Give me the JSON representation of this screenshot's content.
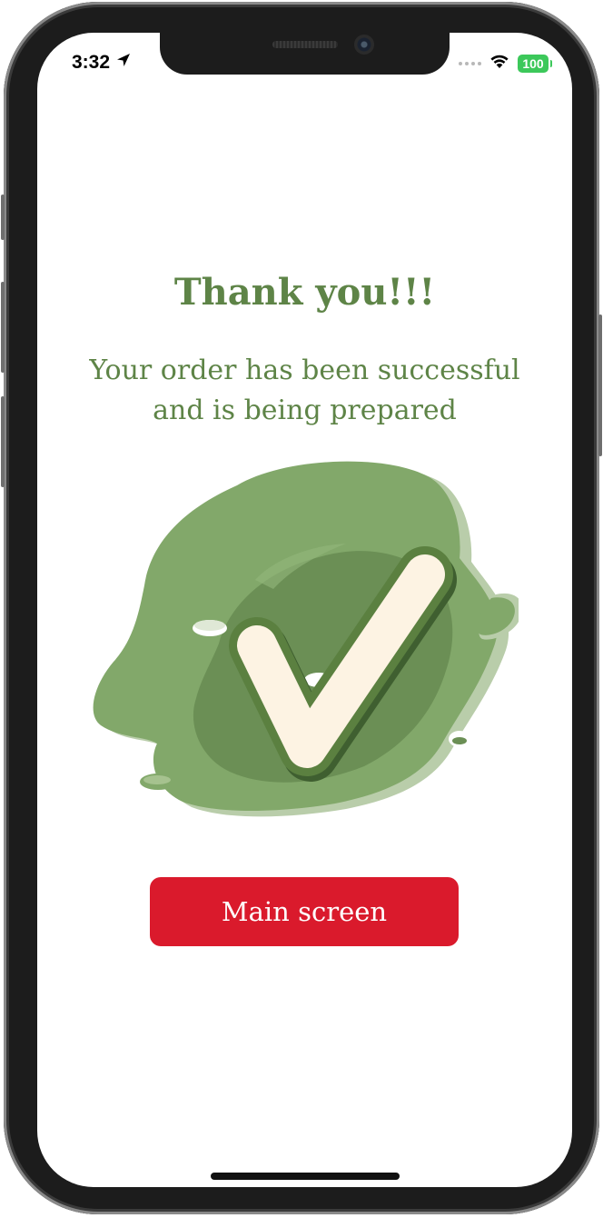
{
  "status_bar": {
    "time": "3:32",
    "battery_level": "100",
    "icons": [
      "location-arrow-icon",
      "cellular-signal-icon",
      "wifi-icon",
      "battery-icon"
    ]
  },
  "confirmation": {
    "title": "Thank you!!!",
    "message_line1": "Your order has been successful",
    "message_line2": "and is being prepared",
    "illustration_icon": "checkmark-splash-icon"
  },
  "actions": {
    "main_screen_label": "Main screen"
  },
  "colors": {
    "accent_green": "#5e8447",
    "splash_light_green": "#82a86a",
    "splash_dark_green": "#6b8f55",
    "check_fill": "#fdf3e3",
    "button_red": "#da1a2c",
    "background": "#ffffff"
  }
}
